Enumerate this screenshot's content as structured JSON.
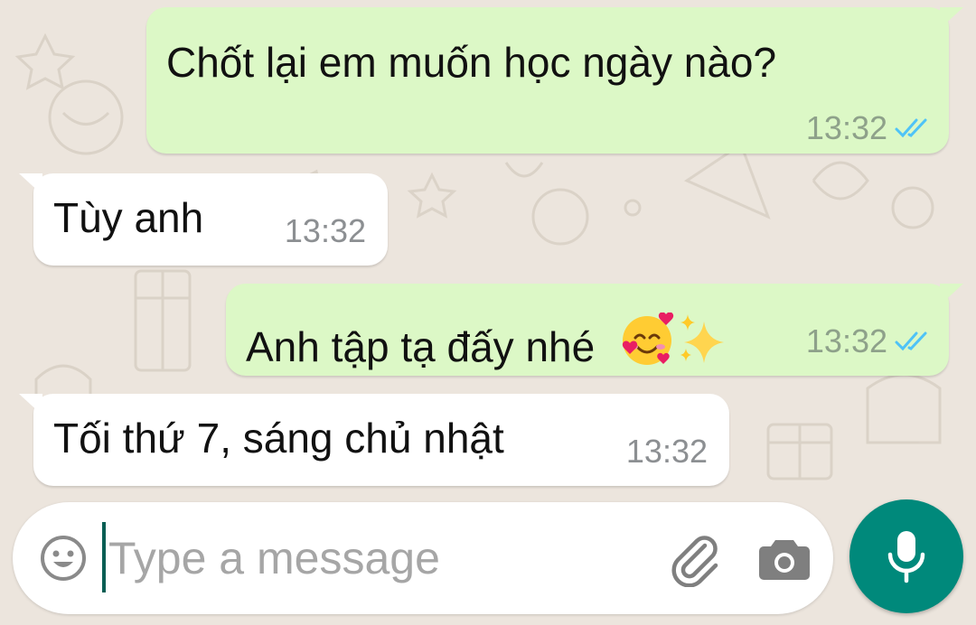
{
  "messages": [
    {
      "direction": "outgoing",
      "text": "Chốt lại em muốn học ngày nào?",
      "time": "13:32",
      "status": "read"
    },
    {
      "direction": "incoming",
      "text": "Tùy anh",
      "time": "13:32"
    },
    {
      "direction": "outgoing",
      "text": "Anh tập tạ đấy nhé",
      "emoji": [
        "smiling-face-with-hearts",
        "sparkles"
      ],
      "time": "13:32",
      "status": "read"
    },
    {
      "direction": "incoming",
      "text": "Tối thứ 7, sáng chủ nhật",
      "time": "13:32"
    }
  ],
  "composer": {
    "placeholder": "Type a message",
    "icons": [
      "emoji-icon",
      "attach-icon",
      "camera-icon"
    ],
    "send_icon": "microphone-icon"
  },
  "colors": {
    "wallpaper": "#ece5dd",
    "outgoing_bubble": "#dcf8c6",
    "incoming_bubble": "#ffffff",
    "read_ticks": "#4fc3f7",
    "mic_button": "#00897b",
    "caret": "#075e54"
  }
}
